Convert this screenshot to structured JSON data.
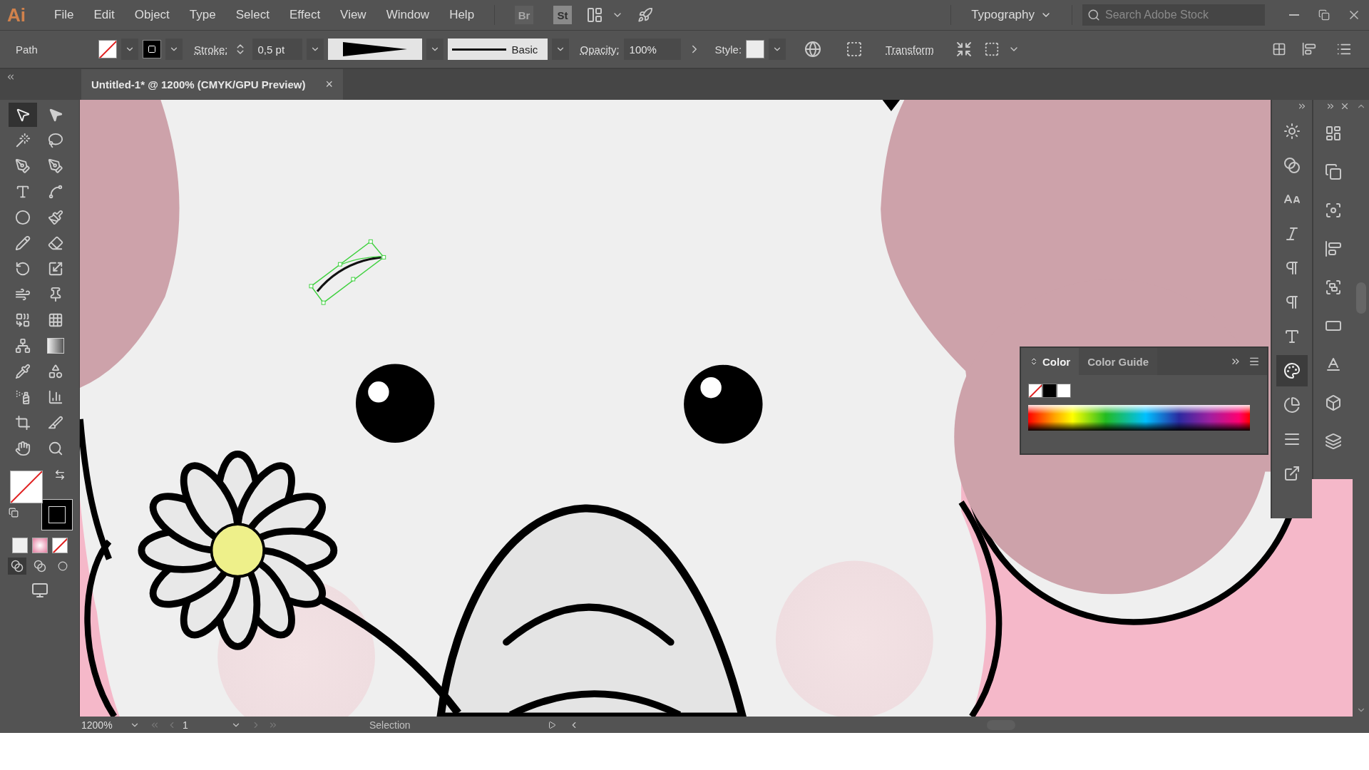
{
  "menu_bar": {
    "logo": "Ai",
    "menus": [
      "File",
      "Edit",
      "Object",
      "Type",
      "Select",
      "Effect",
      "View",
      "Window",
      "Help"
    ],
    "bridge": "Br",
    "stock": "St",
    "workspace": "Typography",
    "search": {
      "placeholder": "Search Adobe Stock"
    }
  },
  "control_bar": {
    "selection": "Path",
    "stroke_label": "Stroke:",
    "stroke_weight": "0,5 pt",
    "brush": "Basic",
    "opacity_label": "Opacity:",
    "opacity": "100%",
    "style_label": "Style:",
    "transform": "Transform"
  },
  "document_tab": {
    "title": "Untitled-1* @ 1200% (CMYK/GPU Preview)",
    "close": "×"
  },
  "tools": [
    {
      "selected": true
    },
    {
      "selected": false
    },
    {
      "selected": false
    },
    {
      "selected": false
    },
    {
      "selected": false
    },
    {
      "selected": false
    },
    {
      "selected": false
    },
    {
      "selected": false
    },
    {
      "selected": false
    },
    {
      "selected": false
    },
    {
      "selected": false
    },
    {
      "selected": false
    },
    {
      "selected": false
    },
    {
      "selected": false
    },
    {
      "selected": false
    },
    {
      "selected": false
    },
    {
      "selected": false
    },
    {
      "selected": false
    },
    {
      "selected": false
    },
    {
      "selected": false
    },
    {
      "selected": false
    },
    {
      "selected": false
    },
    {
      "selected": false
    },
    {
      "selected": false
    },
    {
      "selected": false
    },
    {
      "selected": false
    },
    {
      "selected": false
    },
    {
      "selected": false
    }
  ],
  "color_panel": {
    "tabs": [
      {
        "label": "Color",
        "selected": true
      },
      {
        "label": "Color Guide",
        "selected": false
      }
    ]
  },
  "dock_columns": [
    {
      "icons": [
        {
          "selected": false
        },
        {
          "selected": false
        },
        {
          "selected": false
        },
        {
          "selected": false
        },
        {
          "selected": false
        },
        {
          "selected": false
        },
        {
          "selected": false
        },
        {
          "selected": true
        },
        {
          "selected": false
        },
        {
          "selected": false
        },
        {
          "selected": false
        }
      ]
    },
    {
      "icons": [
        {
          "selected": false
        },
        {
          "selected": false
        },
        {
          "selected": false
        },
        {
          "selected": false
        },
        {
          "selected": false
        },
        {
          "selected": false
        },
        {
          "selected": false
        },
        {
          "selected": false
        },
        {
          "selected": false
        }
      ]
    }
  ],
  "status_bar": {
    "zoom": "1200%",
    "artboard": "1",
    "tool": "Selection"
  }
}
